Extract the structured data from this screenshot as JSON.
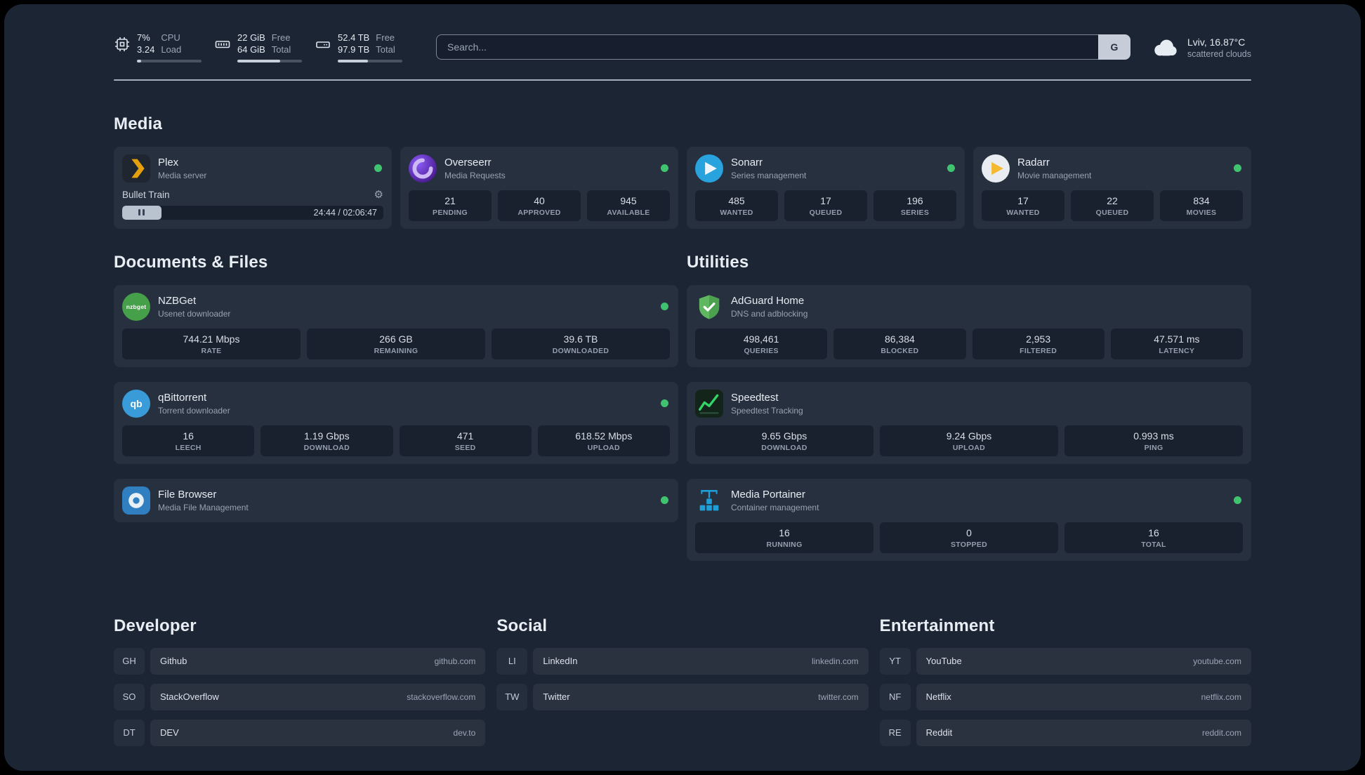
{
  "topbar": {
    "cpu": {
      "value_top": "7%",
      "value_bottom": "3.24",
      "label_top": "CPU",
      "label_bottom": "Load",
      "progress": 7
    },
    "memory": {
      "value_top": "22 GiB",
      "value_bottom": "64 GiB",
      "label_top": "Free",
      "label_bottom": "Total",
      "progress": 66
    },
    "disk": {
      "value_top": "52.4 TB",
      "value_bottom": "97.9 TB",
      "label_top": "Free",
      "label_bottom": "Total",
      "progress": 47
    },
    "search": {
      "placeholder": "Search...",
      "engine_button": "G"
    },
    "weather": {
      "location": "Lviv, 16.87°C",
      "condition": "scattered clouds"
    }
  },
  "media": {
    "header": "Media",
    "plex": {
      "title": "Plex",
      "subtitle": "Media server",
      "now_playing": "Bullet Train",
      "time": "24:44 / 02:06:47",
      "progress": 15
    },
    "overseerr": {
      "title": "Overseerr",
      "subtitle": "Media Requests",
      "stats": [
        {
          "value": "21",
          "label": "PENDING"
        },
        {
          "value": "40",
          "label": "APPROVED"
        },
        {
          "value": "945",
          "label": "AVAILABLE"
        }
      ]
    },
    "sonarr": {
      "title": "Sonarr",
      "subtitle": "Series management",
      "stats": [
        {
          "value": "485",
          "label": "WANTED"
        },
        {
          "value": "17",
          "label": "QUEUED"
        },
        {
          "value": "196",
          "label": "SERIES"
        }
      ]
    },
    "radarr": {
      "title": "Radarr",
      "subtitle": "Movie management",
      "stats": [
        {
          "value": "17",
          "label": "WANTED"
        },
        {
          "value": "22",
          "label": "QUEUED"
        },
        {
          "value": "834",
          "label": "MOVIES"
        }
      ]
    }
  },
  "documents": {
    "header": "Documents & Files",
    "nzbget": {
      "title": "NZBGet",
      "subtitle": "Usenet downloader",
      "stats": [
        {
          "value": "744.21 Mbps",
          "label": "RATE"
        },
        {
          "value": "266 GB",
          "label": "REMAINING"
        },
        {
          "value": "39.6 TB",
          "label": "DOWNLOADED"
        }
      ]
    },
    "qbittorrent": {
      "title": "qBittorrent",
      "subtitle": "Torrent downloader",
      "stats": [
        {
          "value": "16",
          "label": "LEECH"
        },
        {
          "value": "1.19 Gbps",
          "label": "DOWNLOAD"
        },
        {
          "value": "471",
          "label": "SEED"
        },
        {
          "value": "618.52 Mbps",
          "label": "UPLOAD"
        }
      ]
    },
    "filebrowser": {
      "title": "File Browser",
      "subtitle": "Media File Management"
    }
  },
  "utilities": {
    "header": "Utilities",
    "adguard": {
      "title": "AdGuard Home",
      "subtitle": "DNS and adblocking",
      "stats": [
        {
          "value": "498,461",
          "label": "QUERIES"
        },
        {
          "value": "86,384",
          "label": "BLOCKED"
        },
        {
          "value": "2,953",
          "label": "FILTERED"
        },
        {
          "value": "47.571 ms",
          "label": "LATENCY"
        }
      ]
    },
    "speedtest": {
      "title": "Speedtest",
      "subtitle": "Speedtest Tracking",
      "stats": [
        {
          "value": "9.65 Gbps",
          "label": "DOWNLOAD"
        },
        {
          "value": "9.24 Gbps",
          "label": "UPLOAD"
        },
        {
          "value": "0.993 ms",
          "label": "PING"
        }
      ]
    },
    "portainer": {
      "title": "Media Portainer",
      "subtitle": "Container management",
      "stats": [
        {
          "value": "16",
          "label": "RUNNING"
        },
        {
          "value": "0",
          "label": "STOPPED"
        },
        {
          "value": "16",
          "label": "TOTAL"
        }
      ]
    }
  },
  "bookmarks": {
    "developer": {
      "header": "Developer",
      "items": [
        {
          "abbr": "GH",
          "name": "Github",
          "domain": "github.com"
        },
        {
          "abbr": "SO",
          "name": "StackOverflow",
          "domain": "stackoverflow.com"
        },
        {
          "abbr": "DT",
          "name": "DEV",
          "domain": "dev.to"
        }
      ]
    },
    "social": {
      "header": "Social",
      "items": [
        {
          "abbr": "LI",
          "name": "LinkedIn",
          "domain": "linkedin.com"
        },
        {
          "abbr": "TW",
          "name": "Twitter",
          "domain": "twitter.com"
        }
      ]
    },
    "entertainment": {
      "header": "Entertainment",
      "items": [
        {
          "abbr": "YT",
          "name": "YouTube",
          "domain": "youtube.com"
        },
        {
          "abbr": "NF",
          "name": "Netflix",
          "domain": "netflix.com"
        },
        {
          "abbr": "RE",
          "name": "Reddit",
          "domain": "reddit.com"
        }
      ]
    }
  },
  "icons": {
    "gear": "⚙",
    "nzbget_text": "nzbget",
    "qbittorrent_text": "qb"
  },
  "colors": {
    "background": "#1c2534",
    "card": "#27303f",
    "status_online": "#3fc36f",
    "plex_accent": "#e5a00d",
    "overseerr_purple": "#4c1d95",
    "sonarr_blue": "#29a3dd",
    "radarr_amber": "#f5b92d",
    "nzbget_green": "#45a049",
    "qbittorrent_blue": "#3a9bd9",
    "filebrowser_blue": "#2f7fc1",
    "adguard_green": "#5fb760",
    "speedtest_green": "#34d567",
    "portainer_blue": "#1e9fd8"
  }
}
